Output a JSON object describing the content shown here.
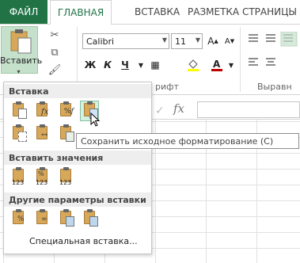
{
  "tabs": {
    "file": "ФАЙЛ",
    "home": "ГЛАВНАЯ",
    "insert": "ВСТАВКА",
    "page_layout": "РАЗМЕТКА СТРАНИЦЫ"
  },
  "ribbon": {
    "paste_label": "Вставить",
    "paste_arrow": "▾",
    "font_name": "Calibri",
    "font_size": "11",
    "bold": "Ж",
    "italic": "К",
    "underline": "Ч",
    "font_group_label": "рифт",
    "alignment_group_label": "Выравн",
    "fx": "fx",
    "font_color": "#c00000",
    "fill_color": "#ffff00",
    "accent_color": "#217346"
  },
  "paste_menu": {
    "section_paste": "Вставка",
    "section_values": "Вставить значения",
    "section_other": "Другие параметры вставки",
    "special": "Специальная вставка...",
    "paste_icons": [
      "paste-icon",
      "paste-formulas-icon",
      "paste-formulas-number-format-icon",
      "keep-source-formatting-icon",
      "no-borders-icon",
      "keep-column-widths-icon",
      "transpose-icon"
    ],
    "value_icons": [
      "paste-values-icon",
      "values-number-format-icon",
      "values-source-formatting-icon"
    ],
    "value_labels": [
      "123",
      "123",
      "123"
    ],
    "other_icons": [
      "formatting-icon",
      "paste-link-icon",
      "picture-icon",
      "linked-picture-icon"
    ]
  },
  "tooltip": "Сохранить исходное форматирование (C)"
}
